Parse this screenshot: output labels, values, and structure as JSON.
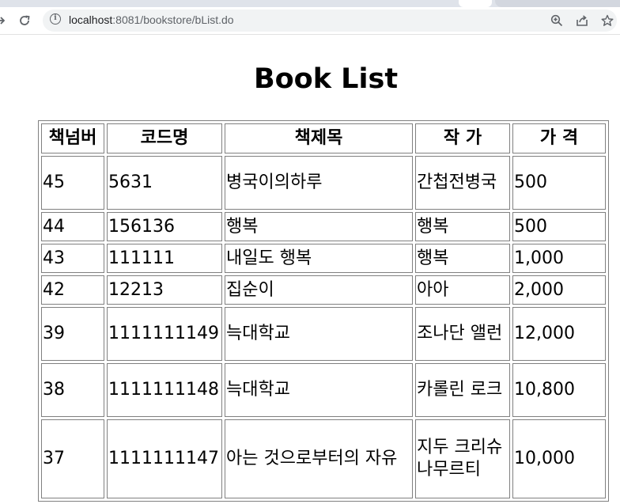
{
  "browser": {
    "url_host": "localhost",
    "url_rest": ":8081/bookstore/bList.do"
  },
  "page": {
    "title": "Book List"
  },
  "table": {
    "headers": [
      "책넘버",
      "코드명",
      "책제목",
      "작 가",
      "가 격"
    ],
    "rows": [
      [
        "45",
        "5631",
        "병국이의하루",
        "간첩전병국",
        "500"
      ],
      [
        "44",
        "156136",
        "행복",
        "행복",
        "500"
      ],
      [
        "43",
        "111111",
        "내일도 행복",
        "행복",
        "1,000"
      ],
      [
        "42",
        "12213",
        "집순이",
        "아아",
        "2,000"
      ],
      [
        "39",
        "1111111149",
        "늑대학교",
        "조나단 앨런",
        "12,000"
      ],
      [
        "38",
        "1111111148",
        "늑대학교",
        "카롤린 로크",
        "10,800"
      ],
      [
        "37",
        "1111111147",
        "아는 것으로부터의 자유",
        "지두 크리슈나무르티",
        "10,000"
      ]
    ]
  },
  "colors": {
    "border": "#808080",
    "tabstrip": "#dfe3ea",
    "omnibox": "#f1f3f4"
  }
}
